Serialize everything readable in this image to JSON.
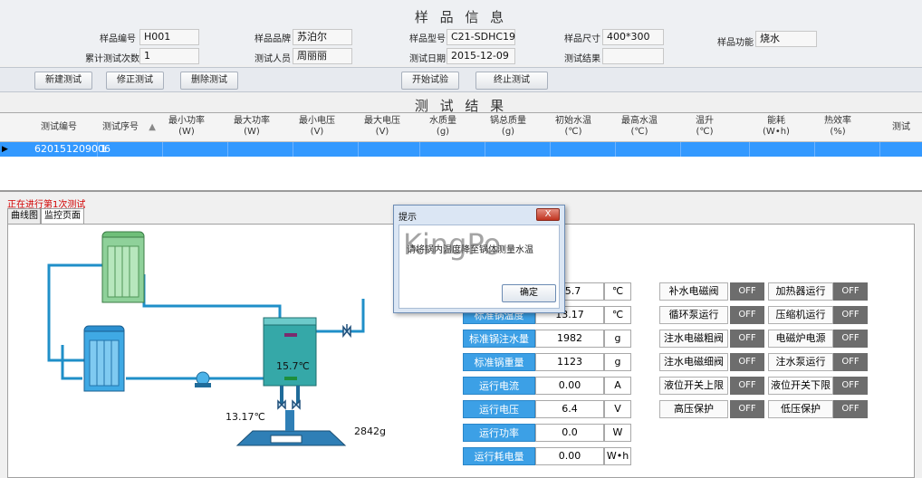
{
  "info": {
    "title": "样 品 信 息",
    "fields": [
      {
        "label": "样品编号",
        "value": "H001"
      },
      {
        "label": "样品品牌",
        "value": "苏泊尔"
      },
      {
        "label": "样品型号",
        "value": "C21-SDHC19"
      },
      {
        "label": "样品尺寸",
        "value": "400*300"
      },
      {
        "label": "样品功能",
        "value": "烧水"
      },
      {
        "label": "累计测试次数",
        "value": "1"
      },
      {
        "label": "测试人员",
        "value": "周丽丽"
      },
      {
        "label": "测试日期",
        "value": "2015-12-09"
      },
      {
        "label": "测试结果",
        "value": ""
      }
    ]
  },
  "toolbar": {
    "new_test": "新建测试",
    "edit_test": "修正测试",
    "delete_test": "删除测试",
    "start_test": "开始试验",
    "stop_test": "终止测试"
  },
  "results": {
    "title": "测 试 结 果",
    "columns": [
      {
        "name": "测试编号",
        "unit": ""
      },
      {
        "name": "测试序号",
        "unit": ""
      },
      {
        "name": "最小功率",
        "unit": "(W)"
      },
      {
        "name": "最大功率",
        "unit": "(W)"
      },
      {
        "name": "最小电压",
        "unit": "(V)"
      },
      {
        "name": "最大电压",
        "unit": "(V)"
      },
      {
        "name": "水质量",
        "unit": "(g)"
      },
      {
        "name": "锅总质量",
        "unit": "(g)"
      },
      {
        "name": "初始水温",
        "unit": "(℃)"
      },
      {
        "name": "最高水温",
        "unit": "(℃)"
      },
      {
        "name": "温升",
        "unit": "(℃)"
      },
      {
        "name": "能耗",
        "unit": "(W•h)"
      },
      {
        "name": "热效率",
        "unit": "(%)"
      },
      {
        "name": "测试",
        "unit": ""
      }
    ],
    "row": {
      "id": "620151209006",
      "seq": "1"
    }
  },
  "status_text": "正在进行第1次测试",
  "tabs": {
    "curve": "曲线图",
    "monitor": "监控页面"
  },
  "diagram": {
    "tank_temp": "15.7℃",
    "pipe_temp": "13.17℃",
    "scale_weight": "2842g"
  },
  "readouts": [
    {
      "label": "",
      "value": "15.7",
      "unit": "℃"
    },
    {
      "label": "标准锅温度",
      "value": "13.17",
      "unit": "℃"
    },
    {
      "label": "标准锅注水量",
      "value": "1982",
      "unit": "g"
    },
    {
      "label": "标准锅重量",
      "value": "1123",
      "unit": "g"
    },
    {
      "label": "运行电流",
      "value": "0.00",
      "unit": "A"
    },
    {
      "label": "运行电压",
      "value": "6.4",
      "unit": "V"
    },
    {
      "label": "运行功率",
      "value": "0.0",
      "unit": "W"
    },
    {
      "label": "运行耗电量",
      "value": "0.00",
      "unit": "W•h"
    }
  ],
  "indicators": [
    {
      "left": "补水电磁阀",
      "left_state": "OFF",
      "right": "加热器运行",
      "right_state": "OFF"
    },
    {
      "left": "循环泵运行",
      "left_state": "OFF",
      "right": "压缩机运行",
      "right_state": "OFF"
    },
    {
      "left": "注水电磁粗阀",
      "left_state": "OFF",
      "right": "电磁炉电源",
      "right_state": "OFF"
    },
    {
      "left": "注水电磁细阀",
      "left_state": "OFF",
      "right": "注水泵运行",
      "right_state": "OFF"
    },
    {
      "left": "液位开关上限",
      "left_state": "OFF",
      "right": "液位开关下限",
      "right_state": "OFF"
    },
    {
      "left": "高压保护",
      "left_state": "OFF",
      "right": "低压保护",
      "right_state": "OFF"
    }
  ],
  "dialog": {
    "title": "提示",
    "message": "请将锅内温度降至锅体测量水温",
    "watermark": "KingPo",
    "ok": "确定",
    "close": "X"
  },
  "colors": {
    "selected_row": "#3399ff",
    "readout_label": "#3ca0e6",
    "indicator_off": "#6d6d6d",
    "status_text": "#d20000"
  }
}
